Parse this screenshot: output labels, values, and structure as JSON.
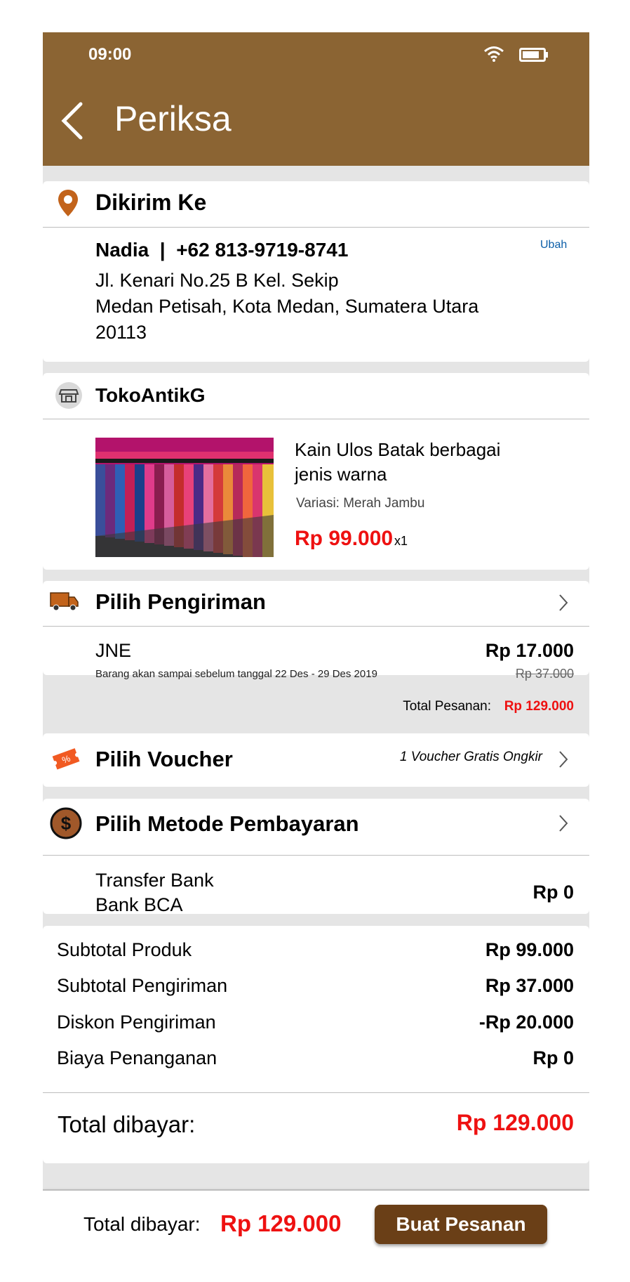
{
  "status_bar": {
    "time": "09:00"
  },
  "header": {
    "title": "Periksa"
  },
  "address": {
    "section_title": "Dikirim Ke",
    "name_phone": "Nadia  |  +62 813-9719-8741",
    "change_link": "Ubah",
    "line1": "Jl. Kenari No.25 B Kel. Sekip",
    "line2": "Medan Petisah, Kota Medan, Sumatera Utara",
    "line3": "20113"
  },
  "shop": {
    "name": "TokoAntikG",
    "product_name_line1": "Kain Ulos Batak berbagai",
    "product_name_line2": "jenis warna",
    "variation": "Variasi: Merah Jambu",
    "price": "Rp 99.000",
    "quantity": "x1"
  },
  "shipping": {
    "section_title": "Pilih Pengiriman",
    "courier": "JNE",
    "estimate": "Barang akan sampai sebelum tanggal 22 Des - 29 Des 2019",
    "price": "Rp 17.000",
    "original_price": "Rp 37.000"
  },
  "order_total": {
    "label": "Total Pesanan:",
    "value": "Rp 129.000"
  },
  "voucher": {
    "section_title": "Pilih Voucher",
    "applied": "1 Voucher Gratis Ongkir"
  },
  "payment": {
    "section_title": "Pilih Metode Pembayaran",
    "method_line1": "Transfer Bank",
    "method_line2": "Bank BCA",
    "fee": "Rp 0"
  },
  "summary": {
    "rows": [
      {
        "label": "Subtotal Produk",
        "value": "Rp 99.000"
      },
      {
        "label": "Subtotal Pengiriman",
        "value": "Rp 37.000"
      },
      {
        "label": "Diskon Pengiriman",
        "value": "-Rp 20.000"
      },
      {
        "label": "Biaya Penanganan",
        "value": "Rp 0"
      }
    ],
    "total_label": "Total dibayar:",
    "total_value": "Rp 129.000"
  },
  "bottom_bar": {
    "total_label": "Total dibayar:",
    "total_value": "Rp 129.000",
    "order_button": "Buat Pesanan"
  },
  "colors": {
    "header": "#8b6433",
    "accent_red": "#ee1111",
    "button": "#6a3f17",
    "voucher_orange": "#f15a22"
  }
}
